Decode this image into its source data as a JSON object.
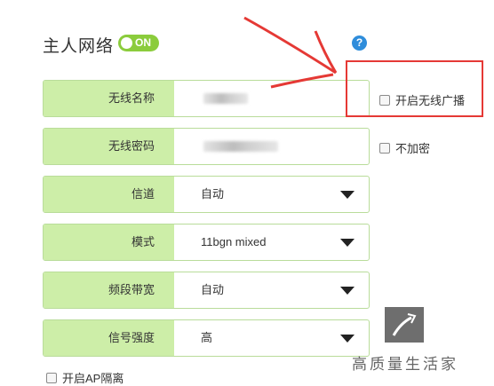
{
  "section": {
    "title": "主人网络",
    "toggle_label": "ON",
    "help_label": "?"
  },
  "fields": [
    {
      "label": "无线名称",
      "value": ""
    },
    {
      "label": "无线密码",
      "value": ""
    },
    {
      "label": "信道",
      "value": "自动"
    },
    {
      "label": "模式",
      "value": "11bgn mixed"
    },
    {
      "label": "频段带宽",
      "value": "自动"
    },
    {
      "label": "信号强度",
      "value": "高"
    }
  ],
  "checkboxes": {
    "broadcast": "开启无线广播",
    "no_encryption": "不加密",
    "ap_isolation": "开启AP隔离"
  },
  "watermark": {
    "text": "高质量生活家"
  },
  "colors": {
    "label_bg": "#cdeea8",
    "border": "#b9dc9a",
    "toggle": "#8bcc3c",
    "annotation": "#e53935",
    "help": "#2f8ddb"
  }
}
